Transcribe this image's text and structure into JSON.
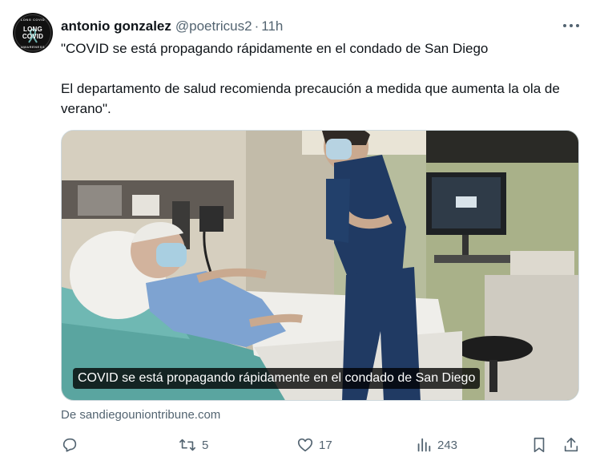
{
  "author": {
    "display_name": "antonio gonzalez",
    "handle": "@poetricus2",
    "separator": "·",
    "time": "11h",
    "avatar_label_1": "LONG",
    "avatar_label_2": "COVID",
    "avatar_ring_top": "LONG COVID",
    "avatar_ring_bottom": "AWARENESS"
  },
  "tweet": {
    "text": "\"COVID se está propagando rápidamente en el condado de San Diego\n\nEl departamento de salud recomienda precaución a medida que aumenta la ola de verano\"."
  },
  "media": {
    "caption": "COVID se está propagando rápidamente en el condado de San Diego"
  },
  "source": {
    "label": "De sandiegouniontribune.com"
  },
  "actions": {
    "reply_count": "",
    "retweet_count": "5",
    "like_count": "17",
    "views_count": "243"
  },
  "icons": {
    "more": "more-horizontal-icon",
    "reply": "reply-icon",
    "retweet": "retweet-icon",
    "like": "heart-icon",
    "views": "views-chart-icon",
    "bookmark": "bookmark-icon",
    "share": "share-icon"
  },
  "colors": {
    "text_primary": "#0f1419",
    "text_secondary": "#536471",
    "border": "#cfd9de"
  }
}
